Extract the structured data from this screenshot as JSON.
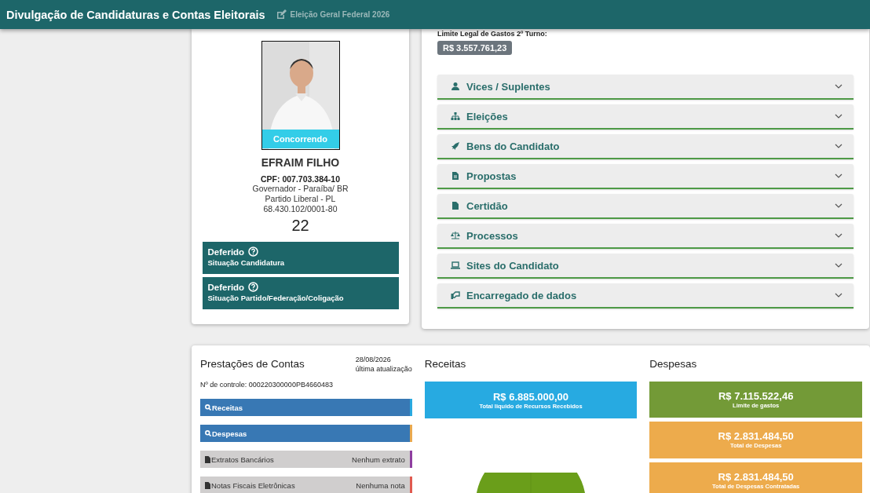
{
  "header": {
    "title": "Divulgação de Candidaturas e Contas Eleitorais",
    "election": "Eleição Geral Federal 2026"
  },
  "candidate": {
    "photo": {
      "kind": "picture"
    },
    "photo_badge": "Concorrendo",
    "name": "EFRAIM FILHO",
    "cpf": "CPF: 007.703.384-10",
    "details": [
      "Governador - Paraíba/ BR",
      "Partido Liberal - PL",
      "68.430.102/0001-80"
    ],
    "number": "22",
    "situations": [
      {
        "status": "Deferido",
        "label": "Situação Candidatura"
      },
      {
        "status": "Deferido",
        "label": "Situação Partido/Federação/Coligação"
      }
    ]
  },
  "spending_limit": {
    "label": "Limite Legal de Gastos 2º Turno:",
    "value": "R$ 3.557.761,23"
  },
  "sections": [
    {
      "kind": "person",
      "label": "Vices / Suplentes",
      "expanded": false
    },
    {
      "kind": "sitemap",
      "label": "Eleições",
      "expanded": false
    },
    {
      "kind": "rocket",
      "label": "Bens do Candidato",
      "expanded": false
    },
    {
      "kind": "filetext",
      "label": "Propostas",
      "expanded": false
    },
    {
      "kind": "file",
      "label": "Certidão",
      "expanded": false
    },
    {
      "kind": "scale",
      "label": "Processos",
      "expanded": false
    },
    {
      "kind": "laptop",
      "label": "Sites do Candidato",
      "expanded": false
    },
    {
      "kind": "handshake",
      "label": "Encarregado de dados",
      "expanded": false
    }
  ],
  "accounts": {
    "title": "Prestações de Contas",
    "date": "28/08/2026",
    "date_label": "última atualização",
    "control": "Nº de controle: 000220300000PB4660483",
    "rows": [
      {
        "kind": "link",
        "label": "Receitas",
        "color": "#29a9e0"
      },
      {
        "kind": "link",
        "label": "Despesas",
        "color": "#eaa94f"
      },
      {
        "kind": "doc",
        "label": "Extratos Bancários",
        "note": "Nenhum extrato",
        "color": "#8e3ea0"
      },
      {
        "kind": "doc",
        "label": "Notas Fiscais Eletrônicas",
        "note": "Nenhuma nota",
        "color": "#e05a4f"
      }
    ]
  },
  "receitas": {
    "title": "Receitas",
    "cards": [
      {
        "value": "R$ 6.885.000,00",
        "label": "Total liquido de Recursos Recebidos",
        "color": "#27aae1"
      }
    ]
  },
  "despesas": {
    "title": "Despesas",
    "cards": [
      {
        "value": "R$ 7.115.522,46",
        "label": "Limite de gastos",
        "color": "#739a37"
      },
      {
        "value": "R$ 2.831.484,50",
        "label": "Total de Despesas",
        "color": "#edab4c"
      },
      {
        "value": "R$ 2.831.484,50",
        "label": "Total de Despesas Contratadas",
        "color": "#edab4c"
      }
    ]
  }
}
